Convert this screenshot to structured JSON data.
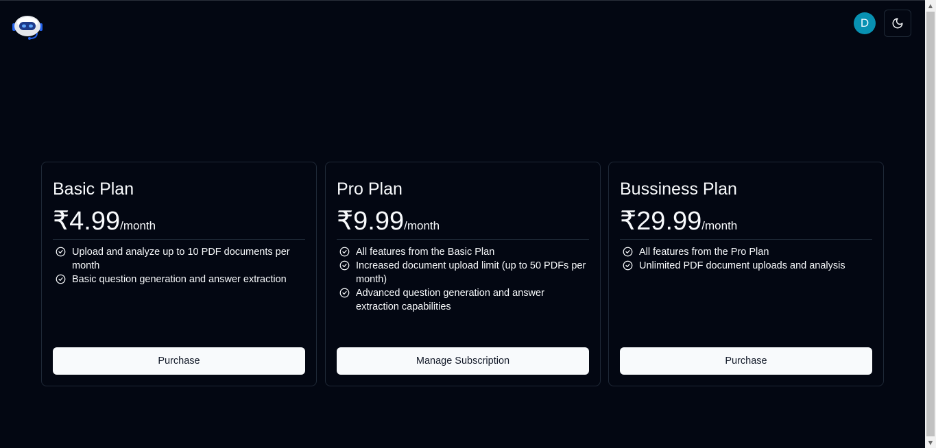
{
  "header": {
    "logo_icon": "robot-logo-icon",
    "avatar_initial": "D",
    "avatar_color": "#0891b2",
    "theme_toggle_icon": "moon-icon"
  },
  "plans": [
    {
      "title": "Basic Plan",
      "price": "₹4.99",
      "period": "/month",
      "features": [
        "Upload and analyze up to 10 PDF documents per month",
        "Basic question generation and answer extraction"
      ],
      "button_label": "Purchase"
    },
    {
      "title": "Pro Plan",
      "price": "₹9.99",
      "period": "/month",
      "features": [
        "All features from the Basic Plan",
        "Increased document upload limit (up to 50 PDFs per month)",
        "Advanced question generation and answer extraction capabilities"
      ],
      "button_label": "Manage Subscription"
    },
    {
      "title": "Bussiness Plan",
      "price": "₹29.99",
      "period": "/month",
      "features": [
        "All features from the Pro Plan",
        "Unlimited PDF document uploads and analysis"
      ],
      "button_label": "Purchase"
    }
  ],
  "colors": {
    "background": "#030712",
    "card_border": "#1f2937",
    "button_bg": "#f8fafc",
    "button_text": "#111827"
  }
}
